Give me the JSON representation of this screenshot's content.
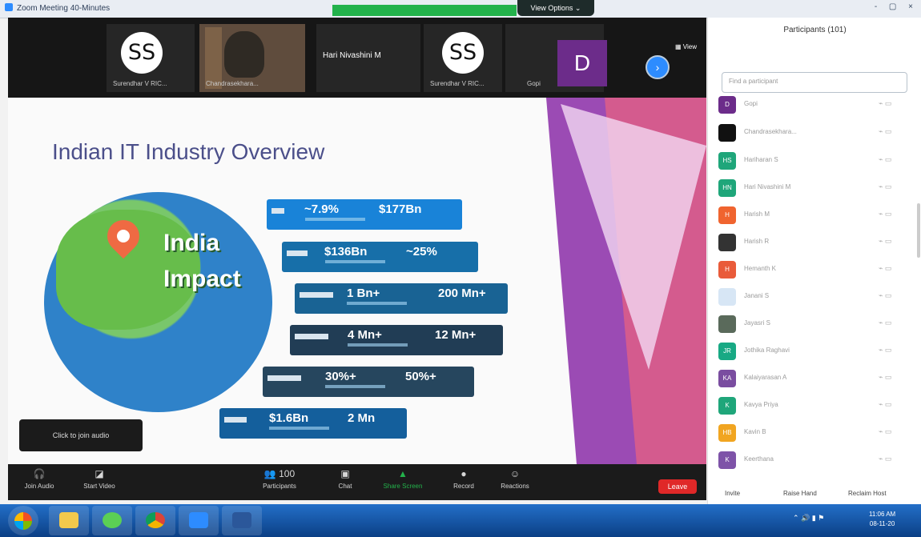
{
  "window": {
    "title": "Zoom Meeting 40-Minutes",
    "view_options": "View Options ⌄",
    "controls": "- ▢ ×"
  },
  "video_strip": {
    "tiles": [
      {
        "initials": "SS",
        "name": "Surendhar V RIC..."
      },
      {
        "name": "Chandrasekhara..."
      },
      {
        "name": "Hari Nivashini M"
      },
      {
        "initials": "SS",
        "name": "Surendhar V RIC..."
      },
      {
        "initials": "D",
        "name": "Gopi"
      }
    ],
    "view_label": "View"
  },
  "slide": {
    "title": "Indian IT Industry Overview",
    "globe_text_1": "India",
    "globe_text_2": "Impact",
    "stats": [
      {
        "a": "~7.9%",
        "b": "$177Bn"
      },
      {
        "a": "$136Bn",
        "b": "~25%"
      },
      {
        "a": "1 Bn+",
        "b": "200 Mn+"
      },
      {
        "a": "4 Mn+",
        "b": "12 Mn+"
      },
      {
        "a": "30%+",
        "b": "50%+"
      },
      {
        "a": "$1.6Bn",
        "b": "2 Mn"
      }
    ],
    "audio_tip": "Click to join audio"
  },
  "toolbar": {
    "join_audio": "Join Audio",
    "start_video": "Start Video",
    "participants": "Participants",
    "participants_count": "100",
    "chat": "Chat",
    "share_screen": "Share Screen",
    "record": "Record",
    "reactions": "Reactions",
    "end": "Leave"
  },
  "panel": {
    "title": "Participants (101)",
    "search_placeholder": "Find a participant",
    "participants": [
      {
        "initials": "D",
        "name": "Gopi",
        "color": "#6c2c8a"
      },
      {
        "initials": "",
        "name": "Chandrasekhara...",
        "color": "#111111"
      },
      {
        "initials": "HS",
        "name": "Hariharan S",
        "color": "#1fa67a"
      },
      {
        "initials": "HN",
        "name": "Hari Nivashini M",
        "color": "#1fa67a"
      },
      {
        "initials": "H",
        "name": "Harish M",
        "color": "#f0642f"
      },
      {
        "initials": "",
        "name": "Harish R",
        "color": "#333333"
      },
      {
        "initials": "H",
        "name": "Hemanth K",
        "color": "#e95b3a"
      },
      {
        "initials": "",
        "name": "Janani S",
        "color": "#d7e6f5"
      },
      {
        "initials": "",
        "name": "Jayasri S",
        "color": "#5a6a5b"
      },
      {
        "initials": "JR",
        "name": "Jothika Raghavi",
        "color": "#18a984"
      },
      {
        "initials": "KA",
        "name": "Kalaiyarasan A",
        "color": "#7a4da0"
      },
      {
        "initials": "K",
        "name": "Kavya Priya",
        "color": "#1fa67a"
      },
      {
        "initials": "HB",
        "name": "Kavin B",
        "color": "#f1a521"
      },
      {
        "initials": "K",
        "name": "Keerthana",
        "color": "#7e53a8"
      }
    ],
    "invite": "Invite",
    "raise_hand": "Raise Hand",
    "reclaim_host": "Reclaim Host"
  },
  "taskbar": {
    "time": "11:06 AM",
    "date": "08-11-20"
  }
}
